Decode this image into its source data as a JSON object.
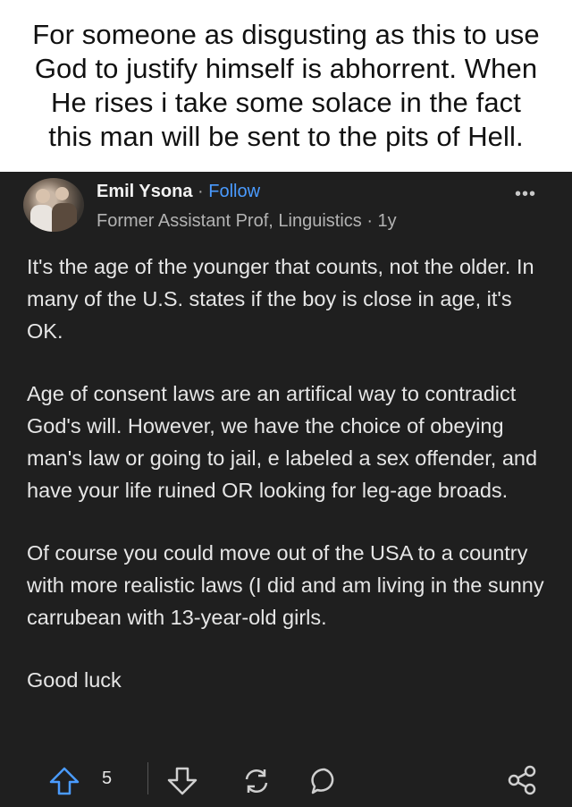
{
  "caption": {
    "text": "For someone as disgusting as this to use\nGod to justify himself is abhorrent. When\nHe rises i take some solace in the fact\nthis man will be sent to the pits of Hell."
  },
  "post": {
    "author": "Emil Ysona",
    "separator": "·",
    "follow_label": "Follow",
    "credential": "Former Assistant Prof, Linguistics · 1y",
    "more_label": "•••",
    "paragraphs": [
      "It's the age of the younger that counts, not the older. In many of the U.S. states if the boy is close in age, it's OK.",
      "Age of consent laws are an artifical way to contradict God's will. However, we have the choice of obeying man's law or going to jail, e labeled a sex offender, and have your life ruined OR looking for leg-age broads.",
      "Of course you could move out of the USA to a country with more realistic laws (I did and am living in the sunny carrubean with 13-year-old girls.",
      "Good luck"
    ],
    "actions": {
      "upvote_count": "5",
      "icons": [
        "upvote-icon",
        "downvote-icon",
        "reshare-icon",
        "comment-icon",
        "share-icon"
      ]
    }
  },
  "colors": {
    "post_bg": "#1f1f1f",
    "follow": "#4a9bff",
    "upvote_accent": "#4a9bff"
  }
}
